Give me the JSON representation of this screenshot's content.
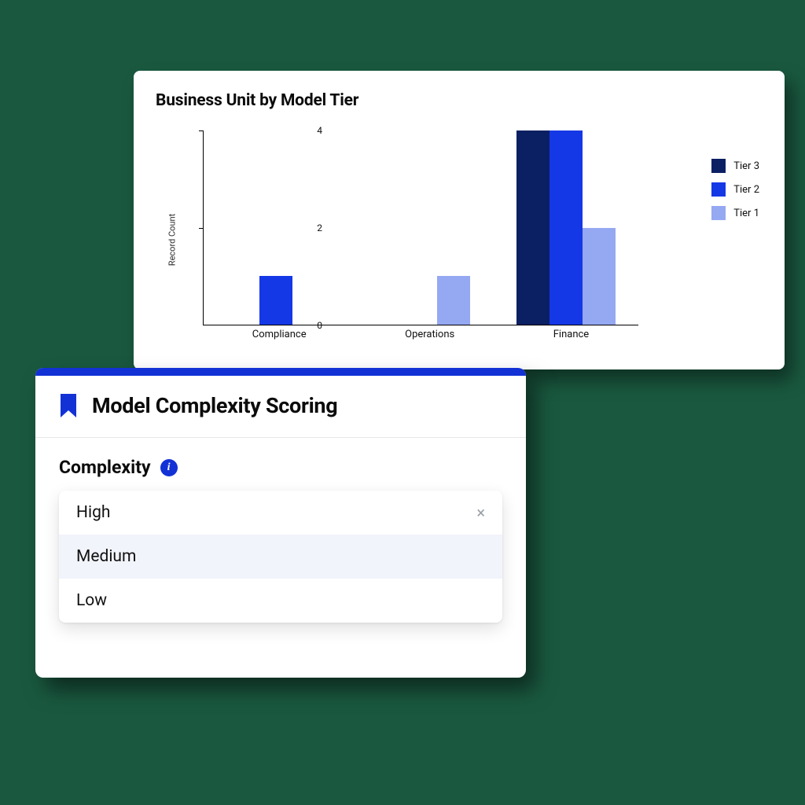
{
  "chart_data": {
    "type": "bar",
    "title": "Business Unit by Model Tier",
    "ylabel": "Record Count",
    "xlabel": "",
    "ylim": [
      0,
      4
    ],
    "yticks": [
      0,
      2,
      4
    ],
    "categories": [
      "Compliance",
      "Operations",
      "Finance"
    ],
    "series": [
      {
        "name": "Tier 3",
        "color": "#0b1f63",
        "values": [
          0,
          0,
          4
        ]
      },
      {
        "name": "Tier 2",
        "color": "#1538e6",
        "values": [
          1,
          0,
          4
        ]
      },
      {
        "name": "Tier 1",
        "color": "#95a8f2",
        "values": [
          0,
          1,
          2
        ]
      }
    ]
  },
  "panel": {
    "title": "Model Complexity Scoring",
    "section_label": "Complexity",
    "info_glyph": "i",
    "options": [
      {
        "label": "High",
        "selected": false,
        "clearable": true
      },
      {
        "label": "Medium",
        "selected": true,
        "clearable": false
      },
      {
        "label": "Low",
        "selected": false,
        "clearable": false
      }
    ],
    "clear_glyph": "×"
  }
}
